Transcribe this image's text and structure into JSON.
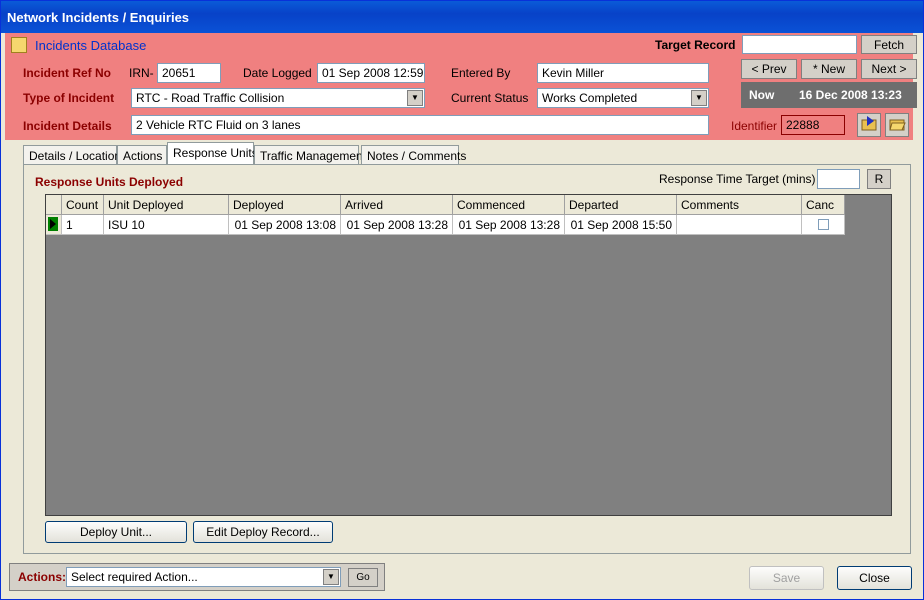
{
  "window": {
    "title": "Network Incidents / Enquiries"
  },
  "header": {
    "app_title": "Incidents Database",
    "target_record_label": "Target Record",
    "target_record_value": "",
    "fetch_button": "Fetch",
    "incident_ref_label": "Incident Ref No",
    "irn_label": "IRN-",
    "irn_value": "20651",
    "date_logged_label": "Date Logged",
    "date_logged_value": "01 Sep 2008 12:59",
    "entered_by_label": "Entered By",
    "entered_by_value": "Kevin Miller",
    "prev_button": "< Prev",
    "new_button": "* New",
    "next_button": "Next >",
    "type_label": "Type of Incident",
    "type_value": "RTC - Road Traffic Collision",
    "status_label": "Current Status",
    "status_value": "Works Completed",
    "now_label": "Now",
    "now_value": "16 Dec 2008 13:23",
    "details_label": "Incident Details",
    "details_value": "2 Vehicle RTC Fluid on 3 lanes",
    "identifier_label": "Identifier",
    "identifier_value": "22888"
  },
  "tabs": [
    {
      "label": "Details / Location"
    },
    {
      "label": "Actions"
    },
    {
      "label": "Response Units"
    },
    {
      "label": "Traffic Management"
    },
    {
      "label": "Notes / Comments"
    }
  ],
  "response_units": {
    "heading": "Response Units Deployed",
    "time_target_label": "Response Time Target (mins)",
    "time_target_value": "",
    "r_button": "R",
    "columns": [
      "Count",
      "Unit Deployed",
      "Deployed",
      "Arrived",
      "Commenced",
      "Departed",
      "Comments",
      "Canc"
    ],
    "rows": [
      {
        "count": "1",
        "unit": "ISU 10",
        "deployed": "01 Sep 2008 13:08",
        "arrived": "01 Sep 2008 13:28",
        "commenced": "01 Sep 2008 13:28",
        "departed": "01 Sep 2008 15:50",
        "comments": "",
        "canc": false
      }
    ],
    "deploy_button": "Deploy Unit...",
    "edit_button": "Edit Deploy Record..."
  },
  "footer": {
    "actions_label": "Actions:",
    "actions_value": "Select required Action...",
    "go_button": "Go",
    "save_button": "Save",
    "close_button": "Close"
  }
}
